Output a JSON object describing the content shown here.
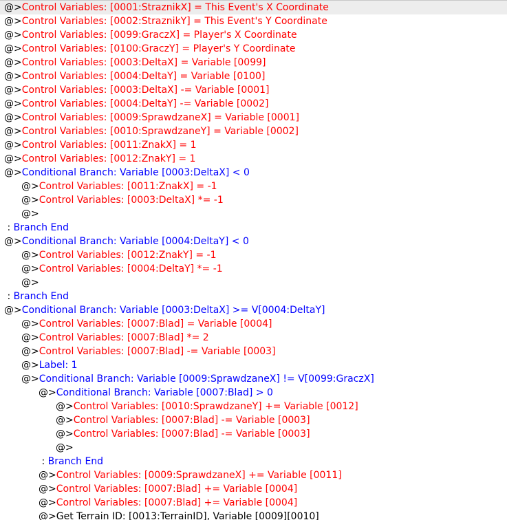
{
  "colors": {
    "red": "#ff0000",
    "blue": "#0000ff",
    "black": "#000000",
    "selected_bg": "#ededed"
  },
  "lines": [
    {
      "indent": 0,
      "prefix": "@>",
      "text": "Control Variables: [0001:StraznikX] = This Event's X Coordinate",
      "color": "red",
      "selected": true
    },
    {
      "indent": 0,
      "prefix": "@>",
      "text": "Control Variables: [0002:StraznikY] = This Event's Y Coordinate",
      "color": "red"
    },
    {
      "indent": 0,
      "prefix": "@>",
      "text": "Control Variables: [0099:GraczX] = Player's X Coordinate",
      "color": "red"
    },
    {
      "indent": 0,
      "prefix": "@>",
      "text": "Control Variables: [0100:GraczY] = Player's Y Coordinate",
      "color": "red"
    },
    {
      "indent": 0,
      "prefix": "@>",
      "text": "Control Variables: [0003:DeltaX] = Variable [0099]",
      "color": "red"
    },
    {
      "indent": 0,
      "prefix": "@>",
      "text": "Control Variables: [0004:DeltaY] = Variable [0100]",
      "color": "red"
    },
    {
      "indent": 0,
      "prefix": "@>",
      "text": "Control Variables: [0003:DeltaX] -= Variable [0001]",
      "color": "red"
    },
    {
      "indent": 0,
      "prefix": "@>",
      "text": "Control Variables: [0004:DeltaY] -= Variable [0002]",
      "color": "red"
    },
    {
      "indent": 0,
      "prefix": "@>",
      "text": "Control Variables: [0009:SprawdzaneX] = Variable [0001]",
      "color": "red"
    },
    {
      "indent": 0,
      "prefix": "@>",
      "text": "Control Variables: [0010:SprawdzaneY] = Variable [0002]",
      "color": "red"
    },
    {
      "indent": 0,
      "prefix": "@>",
      "text": "Control Variables: [0011:ZnakX] = 1",
      "color": "red"
    },
    {
      "indent": 0,
      "prefix": "@>",
      "text": "Control Variables: [0012:ZnakY] = 1",
      "color": "red"
    },
    {
      "indent": 0,
      "prefix": "@>",
      "text": "Conditional Branch: Variable [0003:DeltaX] < 0",
      "color": "blue"
    },
    {
      "indent": 1,
      "prefix": "@>",
      "text": "Control Variables: [0011:ZnakX] = -1",
      "color": "red"
    },
    {
      "indent": 1,
      "prefix": "@>",
      "text": "Control Variables: [0003:DeltaX] *= -1",
      "color": "red"
    },
    {
      "indent": 1,
      "prefix": "@>",
      "text": "",
      "color": "black"
    },
    {
      "indent": 0,
      "prefix": " : ",
      "text": "Branch End",
      "color": "blue"
    },
    {
      "indent": 0,
      "prefix": "@>",
      "text": "Conditional Branch: Variable [0004:DeltaY] < 0",
      "color": "blue"
    },
    {
      "indent": 1,
      "prefix": "@>",
      "text": "Control Variables: [0012:ZnakY] = -1",
      "color": "red"
    },
    {
      "indent": 1,
      "prefix": "@>",
      "text": "Control Variables: [0004:DeltaY] *= -1",
      "color": "red"
    },
    {
      "indent": 1,
      "prefix": "@>",
      "text": "",
      "color": "black"
    },
    {
      "indent": 0,
      "prefix": " : ",
      "text": "Branch End",
      "color": "blue"
    },
    {
      "indent": 0,
      "prefix": "@>",
      "text": "Conditional Branch: Variable [0003:DeltaX] >= V[0004:DeltaY]",
      "color": "blue"
    },
    {
      "indent": 1,
      "prefix": "@>",
      "text": "Control Variables: [0007:Blad] = Variable [0004]",
      "color": "red"
    },
    {
      "indent": 1,
      "prefix": "@>",
      "text": "Control Variables: [0007:Blad] *= 2",
      "color": "red"
    },
    {
      "indent": 1,
      "prefix": "@>",
      "text": "Control Variables: [0007:Blad] -= Variable [0003]",
      "color": "red"
    },
    {
      "indent": 1,
      "prefix": "@>",
      "text": "Label: 1",
      "color": "blue"
    },
    {
      "indent": 1,
      "prefix": "@>",
      "text": "Conditional Branch: Variable [0009:SprawdzaneX] != V[0099:GraczX]",
      "color": "blue"
    },
    {
      "indent": 2,
      "prefix": "@>",
      "text": "Conditional Branch: Variable [0007:Blad] > 0",
      "color": "blue"
    },
    {
      "indent": 3,
      "prefix": "@>",
      "text": "Control Variables: [0010:SprawdzaneY] += Variable [0012]",
      "color": "red"
    },
    {
      "indent": 3,
      "prefix": "@>",
      "text": "Control Variables: [0007:Blad] -= Variable [0003]",
      "color": "red"
    },
    {
      "indent": 3,
      "prefix": "@>",
      "text": "Control Variables: [0007:Blad] -= Variable [0003]",
      "color": "red"
    },
    {
      "indent": 3,
      "prefix": "@>",
      "text": "",
      "color": "black"
    },
    {
      "indent": 2,
      "prefix": " : ",
      "text": "Branch End",
      "color": "blue"
    },
    {
      "indent": 2,
      "prefix": "@>",
      "text": "Control Variables: [0009:SprawdzaneX] += Variable [0011]",
      "color": "red"
    },
    {
      "indent": 2,
      "prefix": "@>",
      "text": "Control Variables: [0007:Blad] += Variable [0004]",
      "color": "red"
    },
    {
      "indent": 2,
      "prefix": "@>",
      "text": "Control Variables: [0007:Blad] += Variable [0004]",
      "color": "red"
    },
    {
      "indent": 2,
      "prefix": "@>",
      "text": "Get Terrain ID: [0013:TerrainID], Variable [0009][0010]",
      "color": "black"
    }
  ]
}
